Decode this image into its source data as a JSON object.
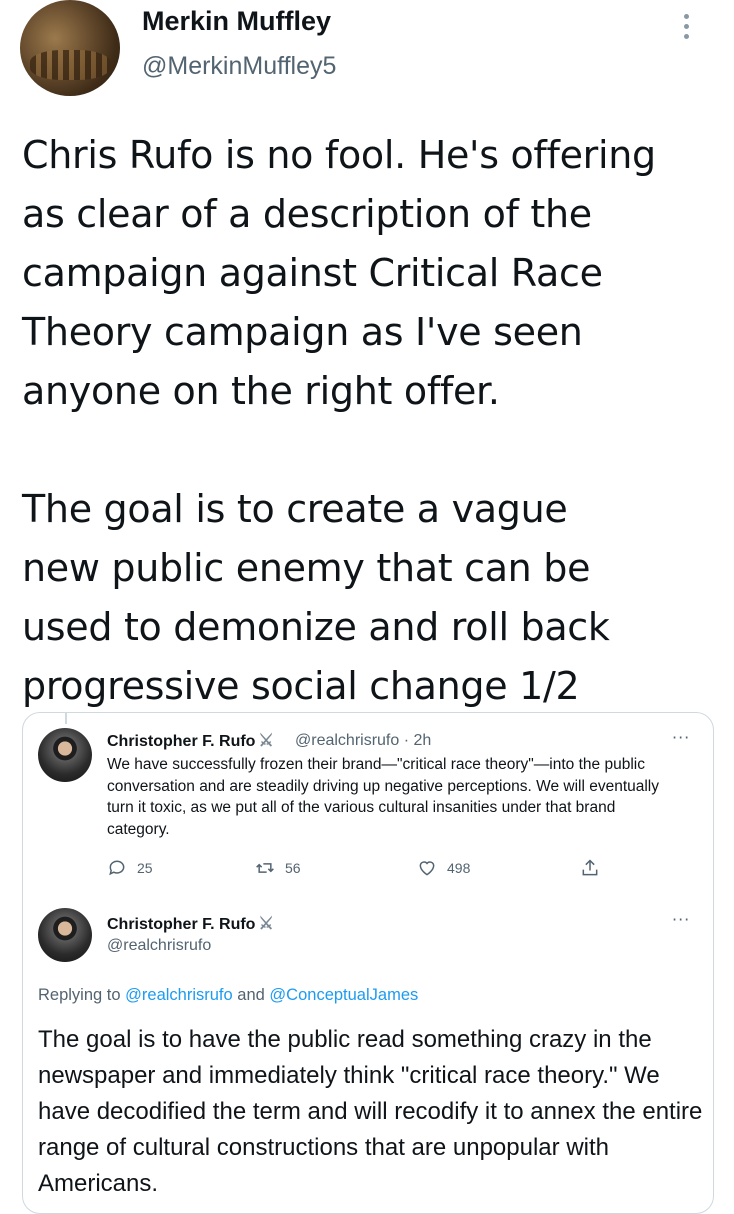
{
  "author": {
    "display_name": "Merkin Muffley",
    "handle": "@MerkinMuffley5"
  },
  "tweet": {
    "text": "Chris Rufo is no fool. He's offering\nas clear of a description of the\ncampaign against Critical Race\nTheory campaign as I've seen\nanyone on the right offer.\n\nThe goal is to create a vague\nnew public enemy that can be\nused to demonize and roll back\nprogressive social change 1/2"
  },
  "quoted_tweet": {
    "name": "Christopher F. Rufo",
    "handle_time": "@realchrisrufo · 2h",
    "text": "We have successfully frozen their brand—\"critical race theory\"—into the public conversation and are steadily driving up negative perceptions. We will eventually turn it toxic, as we put all of the various cultural insanities under that brand category.",
    "replies": "25",
    "retweets": "56",
    "likes": "498"
  },
  "reply_tweet": {
    "name": "Christopher F. Rufo",
    "handle": "@realchrisrufo",
    "replying_prefix": "Replying to",
    "replying_user1": "@realchrisrufo",
    "replying_and": "and",
    "replying_user2": "@ConceptualJames",
    "text": "The goal is to have the public read something crazy in the newspaper and immediately think \"critical race theory.\" We have decodified the term and will recodify it to annex the entire range of cultural constructions that are unpopular with Americans."
  },
  "icons": {
    "more": "more-vertical-icon",
    "more_h": "more-horizontal-icon",
    "reply": "reply-icon",
    "retweet": "retweet-icon",
    "like": "like-icon",
    "share": "share-icon",
    "badge": "crossed-swords-icon"
  }
}
